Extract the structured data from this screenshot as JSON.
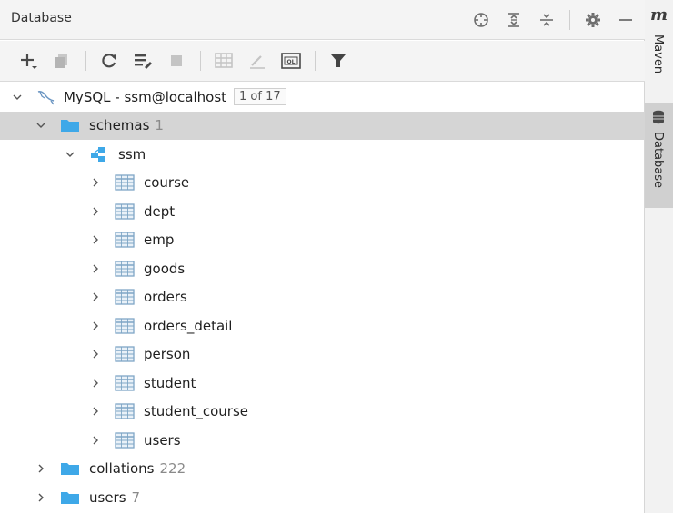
{
  "header": {
    "title": "Database"
  },
  "tree": {
    "root": {
      "label": "MySQL - ssm@localhost",
      "badge": "1 of 17"
    },
    "schemas": {
      "label": "schemas",
      "count": "1"
    },
    "schema": {
      "label": "ssm"
    },
    "tables": [
      "course",
      "dept",
      "emp",
      "goods",
      "orders",
      "orders_detail",
      "person",
      "student",
      "student_course",
      "users"
    ],
    "collations": {
      "label": "collations",
      "count": "222"
    },
    "users": {
      "label": "users",
      "count": "7"
    }
  },
  "side_stripe": {
    "logo": "m",
    "maven_label": "Maven",
    "database_label": "Database"
  },
  "colors": {
    "selection": "#d5d5d5",
    "folder_blue": "#3ea8e8",
    "table_grid": "#7fa6c6",
    "filter_dark": "#444444"
  }
}
